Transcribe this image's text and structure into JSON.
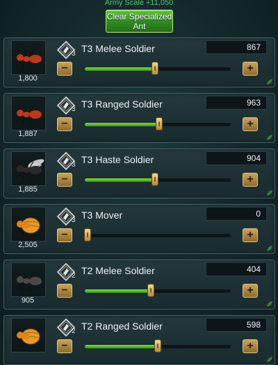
{
  "header": {
    "army_scale": "Army Scale +11,050",
    "clear_button": "Clear Specialized Ant"
  },
  "units": [
    {
      "name": "T3 Melee Soldier",
      "tier": "3",
      "count": "1,800",
      "quantity": "867",
      "fill_fraction": 0.48,
      "ant": "red"
    },
    {
      "name": "T3 Ranged Soldier",
      "tier": "3",
      "count": "1,887",
      "quantity": "963",
      "fill_fraction": 0.51,
      "ant": "red"
    },
    {
      "name": "T3 Haste Soldier",
      "tier": "3",
      "count": "1,885",
      "quantity": "904",
      "fill_fraction": 0.48,
      "ant": "winged"
    },
    {
      "name": "T3 Mover",
      "tier": "3",
      "count": "2,505",
      "quantity": "0",
      "fill_fraction": 0.0,
      "ant": "orange"
    },
    {
      "name": "T2 Melee Soldier",
      "tier": "2",
      "count": "905",
      "quantity": "404",
      "fill_fraction": 0.45,
      "ant": "grey"
    },
    {
      "name": "T2 Ranged Soldier",
      "tier": "2",
      "count": "",
      "quantity": "598",
      "fill_fraction": 0.5,
      "ant": "orange"
    }
  ],
  "colors": {
    "accent_green": "#4fc96a",
    "slider_fill": "#7bd93c",
    "button_gold": "#c9a25a"
  },
  "icons": {
    "minus": "−",
    "plus": "+"
  }
}
